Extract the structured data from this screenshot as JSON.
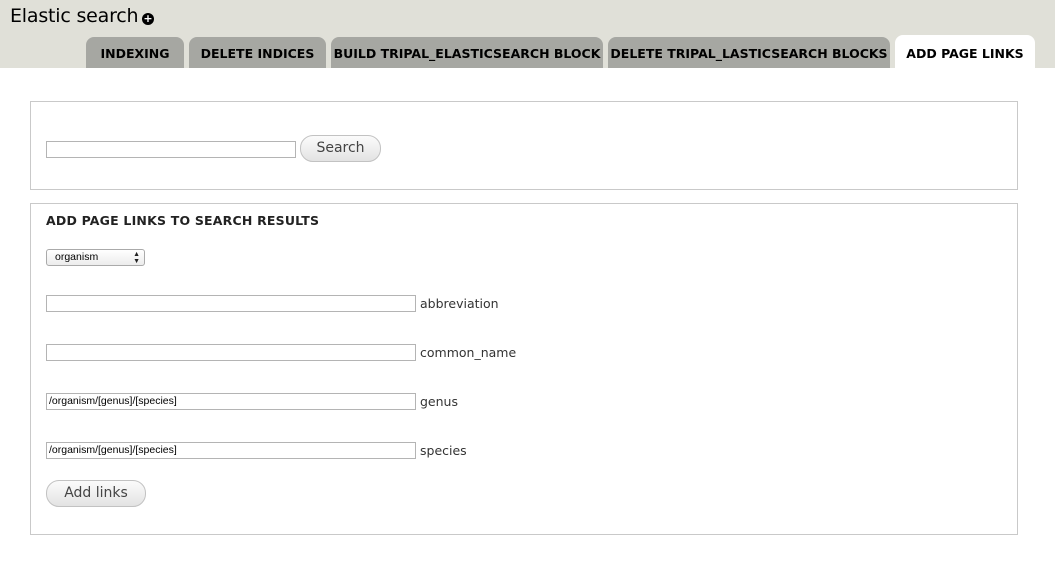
{
  "header": {
    "title": "Elastic search",
    "shortcut_icon": "plus-circle-icon"
  },
  "tabs": [
    {
      "label": "INDEXING",
      "active": false
    },
    {
      "label": "DELETE INDICES",
      "active": false
    },
    {
      "label": "BUILD TRIPAL_ELASTICSEARCH BLOCK",
      "active": false
    },
    {
      "label": "DELETE TRIPAL_LASTICSEARCH BLOCKS",
      "active": false
    },
    {
      "label": "ADD PAGE LINKS",
      "active": true
    }
  ],
  "search_form": {
    "input_value": "",
    "button_label": "Search"
  },
  "links_form": {
    "title": "ADD PAGE LINKS TO SEARCH RESULTS",
    "table_select": {
      "selected": "organism",
      "arrow_icon": "updown-arrows-icon"
    },
    "fields": [
      {
        "label": "abbreviation",
        "value": ""
      },
      {
        "label": "common_name",
        "value": ""
      },
      {
        "label": "genus",
        "value": "/organism/[genus]/[species]"
      },
      {
        "label": "species",
        "value": "/organism/[genus]/[species]"
      }
    ],
    "submit_label": "Add links"
  },
  "colors": {
    "header_bg": "#e0e0d8",
    "tab_bg": "#a6a7a2",
    "active_tab_bg": "#ffffff",
    "border": "#c9c9c9"
  }
}
